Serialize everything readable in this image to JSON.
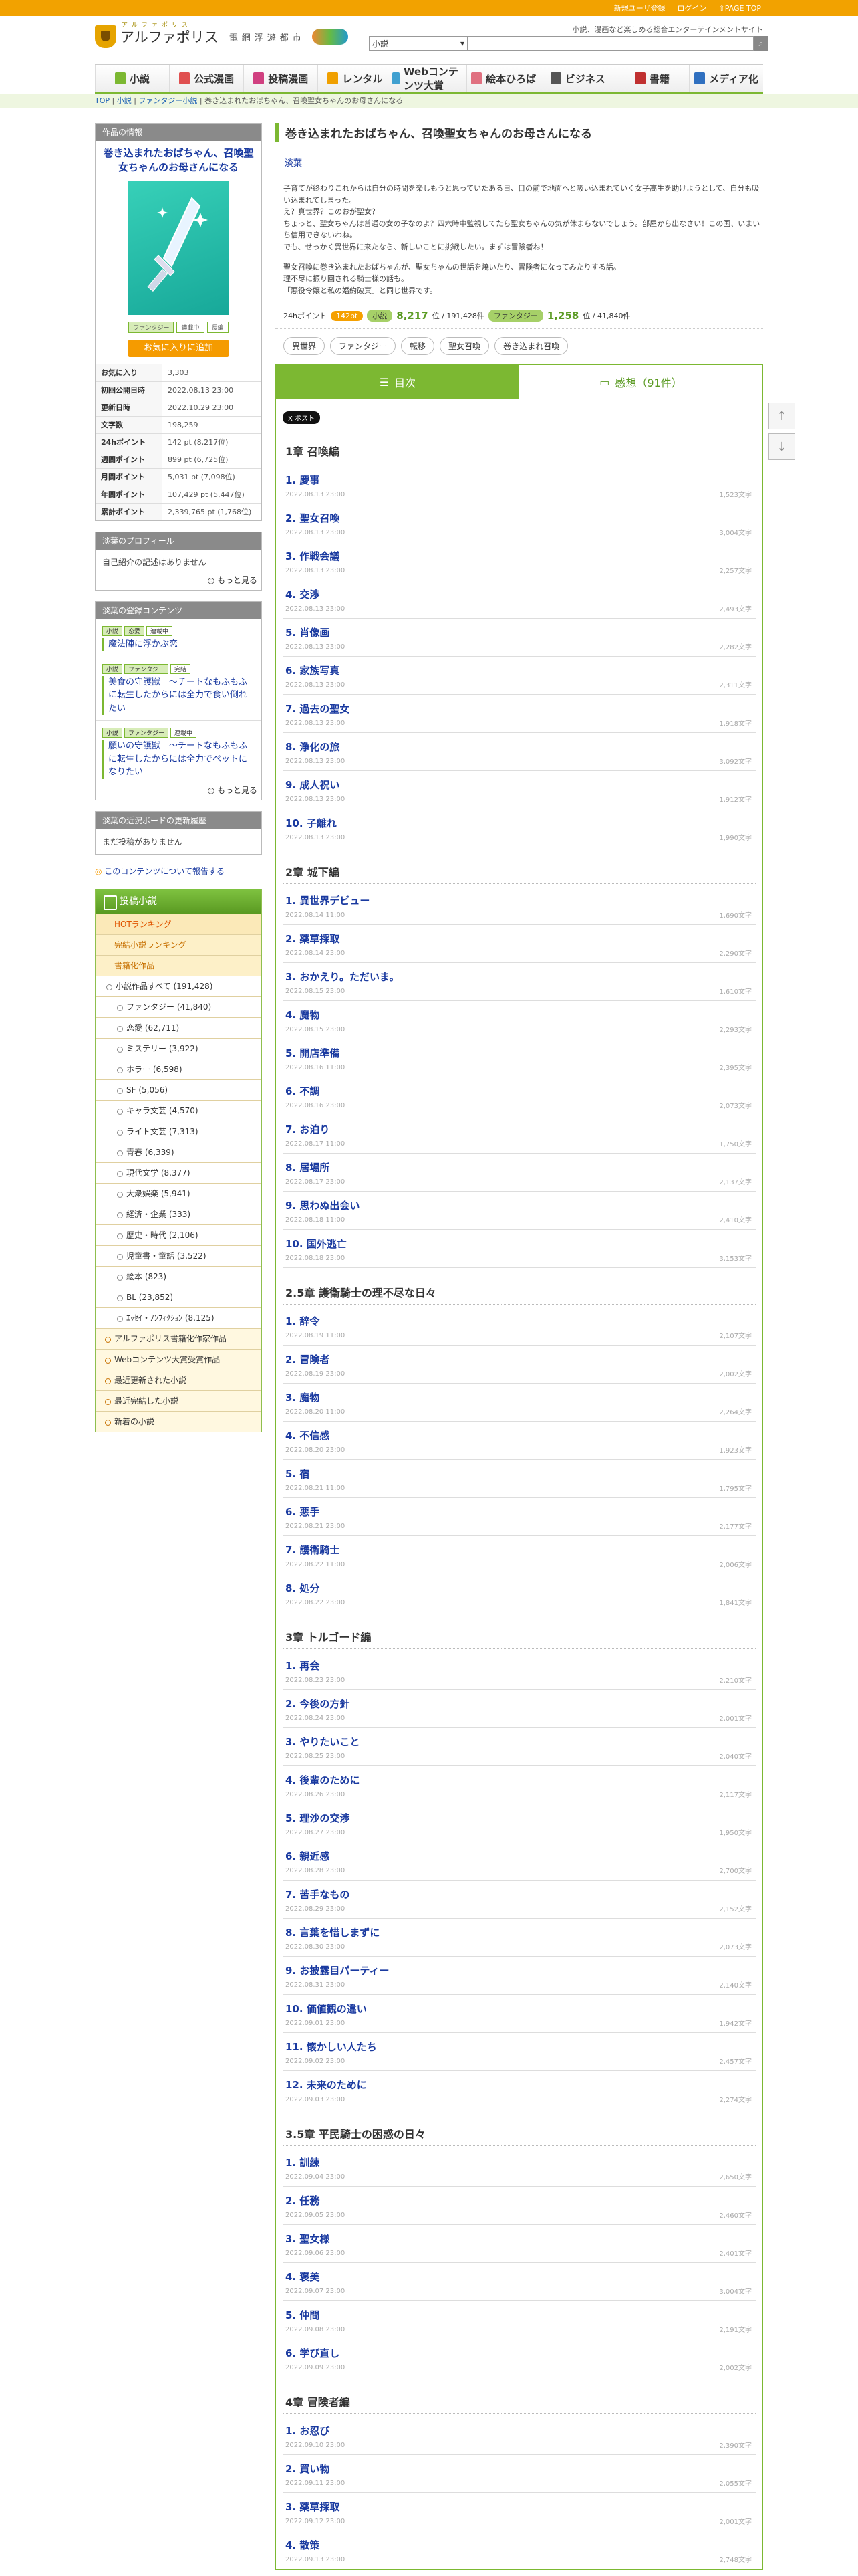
{
  "topbar": {
    "register": "新規ユーザ登録",
    "login": "ログイン",
    "pagetop": "⇧PAGE TOP"
  },
  "header": {
    "logo_name": "アルファポリス",
    "logo_kana": "アルファポリス",
    "logo_tag": "電網浮遊都市",
    "tagline": "小説、漫画など楽しめる総合エンターテインメントサイト",
    "search_select": "小説"
  },
  "nav": [
    {
      "label": "小説",
      "color": "#7cb832"
    },
    {
      "label": "公式漫画",
      "color": "#e05050"
    },
    {
      "label": "投稿漫画",
      "color": "#d04080"
    },
    {
      "label": "レンタル",
      "color": "#f0a000"
    },
    {
      "label": "Webコンテンツ大賞",
      "color": "#40a0d0"
    },
    {
      "label": "絵本ひろば",
      "color": "#e07080"
    },
    {
      "label": "ビジネス",
      "color": "#555555"
    },
    {
      "label": "書籍",
      "color": "#c03030"
    },
    {
      "label": "メディア化",
      "color": "#3070c0"
    }
  ],
  "breadcrumb": {
    "top": "TOP",
    "novel": "小説",
    "fantasy": "ファンタジー小説",
    "current": "巻き込まれたおばちゃん、召喚聖女ちゃんのお母さんになる"
  },
  "work": {
    "head": "作品の情報",
    "title": "巻き込まれたおばちゃん、召喚聖女ちゃんのお母さんになる",
    "tags": [
      "ファンタジー",
      "連載中",
      "長編"
    ],
    "fav_button": "お気に入りに追加",
    "stats": [
      [
        "お気に入り",
        "3,303"
      ],
      [
        "初回公開日時",
        "2022.08.13 23:00"
      ],
      [
        "更新日時",
        "2022.10.29 23:00"
      ],
      [
        "文字数",
        "198,259"
      ],
      [
        "24hポイント",
        "142 pt (8,217位)"
      ],
      [
        "週間ポイント",
        "899 pt (6,725位)"
      ],
      [
        "月間ポイント",
        "5,031 pt (7,098位)"
      ],
      [
        "年間ポイント",
        "107,429 pt (5,447位)"
      ],
      [
        "累計ポイント",
        "2,339,765 pt (1,768位)"
      ]
    ]
  },
  "profile": {
    "head": "淡葉のプロフィール",
    "text": "自己紹介の記述はありません",
    "more": "もっと見る"
  },
  "contents": {
    "head": "淡葉の登録コンテンツ",
    "items": [
      {
        "tags": [
          "小説",
          "恋愛",
          "連載中"
        ],
        "title": "魔法陣に浮かぶ恋"
      },
      {
        "tags": [
          "小説",
          "ファンタジー",
          "完結"
        ],
        "title": "美食の守護獣　〜チートなもふもふに転生したからには全力で食い倒れたい"
      },
      {
        "tags": [
          "小説",
          "ファンタジー",
          "連載中"
        ],
        "title": "願いの守護獣　〜チートなもふもふに転生したからには全力でペットになりたい"
      }
    ],
    "more": "もっと見る"
  },
  "board": {
    "head": "淡葉の近況ボードの更新履歴",
    "text": "まだ投稿がありません"
  },
  "report": "このコンテンツについて報告する",
  "ranking": {
    "head": "投稿小説",
    "hot": "HOTランキング",
    "items_orange": [
      "完結小説ランキング",
      "書籍化作品"
    ],
    "all": "小説作品すべて (191,428)",
    "genres": [
      "ファンタジー (41,840)",
      "恋愛 (62,711)",
      "ミステリー (3,922)",
      "ホラー (6,598)",
      "SF (5,056)",
      "キャラ文芸 (4,570)",
      "ライト文芸 (7,313)",
      "青春 (6,339)",
      "現代文学 (8,377)",
      "大衆娯楽 (5,941)",
      "経済・企業 (333)",
      "歴史・時代 (2,106)",
      "児童書・童話 (3,522)",
      "絵本 (823)",
      "BL (23,852)",
      "ｴｯｾｲ・ﾉﾝﾌｨｸｼｮﾝ (8,125)"
    ],
    "footer": [
      "アルファポリス書籍化作家作品",
      "Webコンテンツ大賞受賞作品",
      "最近更新された小説",
      "最近完結した小説",
      "新着の小説"
    ]
  },
  "main": {
    "title": "巻き込まれたおばちゃん、召喚聖女ちゃんのお母さんになる",
    "author": "淡葉",
    "intro": [
      "子育てが終わりこれからは自分の時間を楽しもうと思っていたある日、目の前で地面へと吸い込まれていく女子高生を助けようとして、自分も吸い込まれてしまった。",
      "え？真世界？このおが聖女？",
      "ちょっと、聖女ちゃんは普通の女の子なのよ？四六時中監視してたら聖女ちゃんの気が休まらないでしょう。部屋から出なさい！この国、いまいち信用できないわね。",
      "でも、せっかく異世界に来たなら、新しいことに挑戦したい。まずは冒険者ね！",
      "聖女召喚に巻き込まれたおばちゃんが、聖女ちゃんの世話を焼いたり、冒険者になってみたりする話。",
      "理不尽に振り回される騎士様の話も。",
      "「悪役令嬢と私の婚約破棄」と同じ世界です。"
    ],
    "points": {
      "label": "24hポイント",
      "value": "142pt",
      "genre1": "小説",
      "rank1": "8,217",
      "rank1_total": "位 / 191,428件",
      "genre2": "ファンタジー",
      "rank2": "1,258",
      "rank2_total": "位 / 41,840件"
    },
    "keywords": [
      "異世界",
      "ファンタジー",
      "転移",
      "聖女召喚",
      "巻き込まれ召喚"
    ],
    "tabs": {
      "toc": "目次",
      "reviews": "感想（91件）"
    },
    "x_label": "X ポスト"
  },
  "toc": [
    {
      "chapter": "1章 召喚編",
      "eps": [
        [
          "1. 慶事",
          "2022.08.13 23:00",
          "1,523文字"
        ],
        [
          "2. 聖女召喚",
          "2022.08.13 23:00",
          "3,004文字"
        ],
        [
          "3. 作戦会議",
          "2022.08.13 23:00",
          "2,257文字"
        ],
        [
          "4. 交渉",
          "2022.08.13 23:00",
          "2,493文字"
        ],
        [
          "5. 肖像画",
          "2022.08.13 23:00",
          "2,282文字"
        ],
        [
          "6. 家族写真",
          "2022.08.13 23:00",
          "2,311文字"
        ],
        [
          "7. 過去の聖女",
          "2022.08.13 23:00",
          "1,918文字"
        ],
        [
          "8. 浄化の旅",
          "2022.08.13 23:00",
          "3,092文字"
        ],
        [
          "9. 成人祝い",
          "2022.08.13 23:00",
          "1,912文字"
        ],
        [
          "10. 子離れ",
          "2022.08.13 23:00",
          "1,990文字"
        ]
      ]
    },
    {
      "chapter": "2章 城下編",
      "eps": [
        [
          "1. 異世界デビュー",
          "2022.08.14 11:00",
          "1,690文字"
        ],
        [
          "2. 薬草採取",
          "2022.08.14 23:00",
          "2,290文字"
        ],
        [
          "3. おかえり。ただいま。",
          "2022.08.15 23:00",
          "1,610文字"
        ],
        [
          "4. 魔物",
          "2022.08.15 23:00",
          "2,293文字"
        ],
        [
          "5. 開店準備",
          "2022.08.16 11:00",
          "2,395文字"
        ],
        [
          "6. 不調",
          "2022.08.16 23:00",
          "2,073文字"
        ],
        [
          "7. お泊り",
          "2022.08.17 11:00",
          "1,750文字"
        ],
        [
          "8. 居場所",
          "2022.08.17 23:00",
          "2,137文字"
        ],
        [
          "9. 思わぬ出会い",
          "2022.08.18 11:00",
          "2,410文字"
        ],
        [
          "10. 国外逃亡",
          "2022.08.18 23:00",
          "3,153文字"
        ]
      ]
    },
    {
      "chapter": "2.5章 護衛騎士の理不尽な日々",
      "eps": [
        [
          "1. 辞令",
          "2022.08.19 11:00",
          "2,107文字"
        ],
        [
          "2. 冒険者",
          "2022.08.19 23:00",
          "2,002文字"
        ],
        [
          "3. 魔物",
          "2022.08.20 11:00",
          "2,264文字"
        ],
        [
          "4. 不信感",
          "2022.08.20 23:00",
          "1,923文字"
        ],
        [
          "5. 宿",
          "2022.08.21 11:00",
          "1,795文字"
        ],
        [
          "6. 悪手",
          "2022.08.21 23:00",
          "2,177文字"
        ],
        [
          "7. 護衛騎士",
          "2022.08.22 11:00",
          "2,006文字"
        ],
        [
          "8. 処分",
          "2022.08.22 23:00",
          "1,841文字"
        ]
      ]
    },
    {
      "chapter": "3章 トルゴード編",
      "eps": [
        [
          "1. 再会",
          "2022.08.23 23:00",
          "2,210文字"
        ],
        [
          "2. 今後の方針",
          "2022.08.24 23:00",
          "2,001文字"
        ],
        [
          "3. やりたいこと",
          "2022.08.25 23:00",
          "2,040文字"
        ],
        [
          "4. 後輩のために",
          "2022.08.26 23:00",
          "2,117文字"
        ],
        [
          "5. 理沙の交渉",
          "2022.08.27 23:00",
          "1,950文字"
        ],
        [
          "6. 親近感",
          "2022.08.28 23:00",
          "2,700文字"
        ],
        [
          "7. 苦手なもの",
          "2022.08.29 23:00",
          "2,152文字"
        ],
        [
          "8. 言葉を惜しまずに",
          "2022.08.30 23:00",
          "2,073文字"
        ],
        [
          "9. お披露目パーティー",
          "2022.08.31 23:00",
          "2,140文字"
        ],
        [
          "10. 価値観の違い",
          "2022.09.01 23:00",
          "1,942文字"
        ],
        [
          "11. 懐かしい人たち",
          "2022.09.02 23:00",
          "2,457文字"
        ],
        [
          "12. 未来のために",
          "2022.09.03 23:00",
          "2,274文字"
        ]
      ]
    },
    {
      "chapter": "3.5章 平民騎士の困惑の日々",
      "eps": [
        [
          "1. 訓練",
          "2022.09.04 23:00",
          "2,650文字"
        ],
        [
          "2. 任務",
          "2022.09.05 23:00",
          "2,460文字"
        ],
        [
          "3. 聖女様",
          "2022.09.06 23:00",
          "2,401文字"
        ],
        [
          "4. 褒美",
          "2022.09.07 23:00",
          "3,004文字"
        ],
        [
          "5. 仲間",
          "2022.09.08 23:00",
          "2,191文字"
        ],
        [
          "6. 学び直し",
          "2022.09.09 23:00",
          "2,002文字"
        ]
      ]
    },
    {
      "chapter": "4章 冒険者編",
      "eps": [
        [
          "1. お忍び",
          "2022.09.10 23:00",
          "2,390文字"
        ],
        [
          "2. 買い物",
          "2022.09.11 23:00",
          "2,055文字"
        ],
        [
          "3. 薬草採取",
          "2022.09.12 23:00",
          "2,001文字"
        ],
        [
          "4. 散策",
          "2022.09.13 23:00",
          "2,748文字"
        ]
      ]
    }
  ],
  "colors": {
    "accent": "#7cb832",
    "orange": "#f59b00",
    "link": "#1a3aa0"
  }
}
